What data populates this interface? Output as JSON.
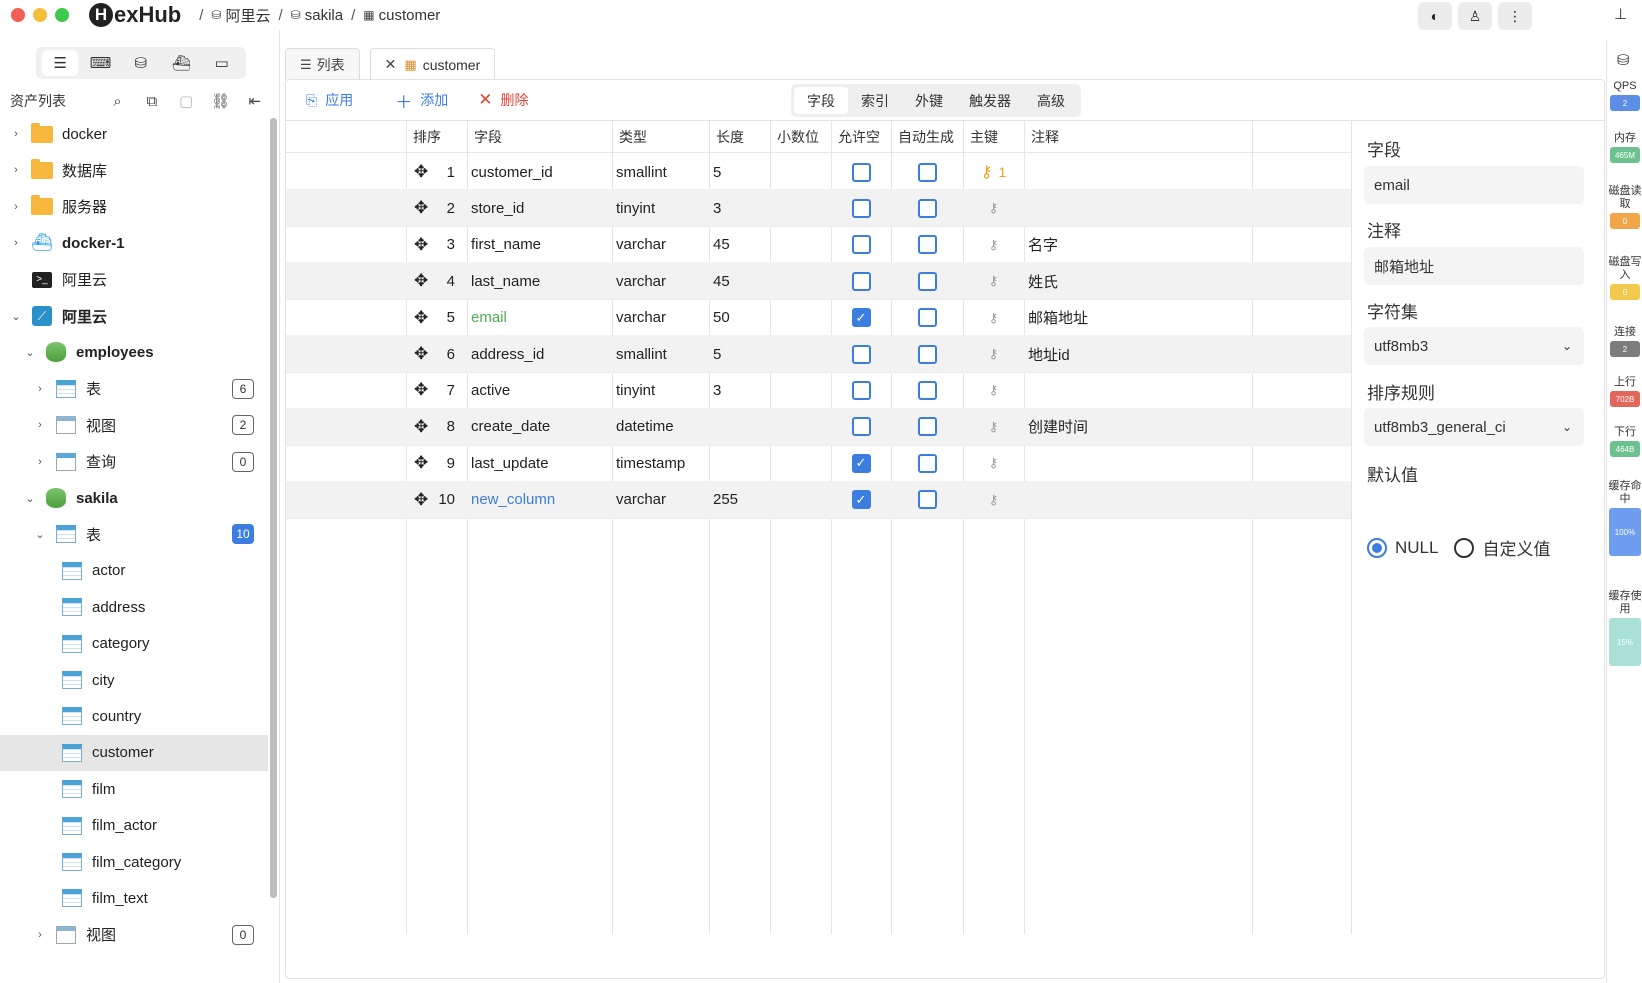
{
  "app": {
    "brand": "HexHub",
    "brand_initial": "H",
    "brand_rest": "exHub",
    "breadcrumbs": [
      "阿里云",
      "sakila",
      "customer"
    ]
  },
  "sidebar": {
    "asset_label": "资产列表",
    "tree": [
      {
        "label": "docker",
        "icon": "folder-icon",
        "chevron": "›"
      },
      {
        "label": "数据库",
        "icon": "folder-icon",
        "chevron": "›"
      },
      {
        "label": "服务器",
        "icon": "folder-icon",
        "chevron": "›"
      },
      {
        "label": "docker-1",
        "icon": "docker-icon",
        "chevron": "›"
      },
      {
        "label": "阿里云",
        "icon": "terminal-icon",
        "chevron": ""
      },
      {
        "label": "阿里云",
        "icon": "cloud-server-icon",
        "chevron": "⌄"
      },
      {
        "label": "employees",
        "icon": "database-icon",
        "chevron": "⌄"
      },
      {
        "label": "表",
        "icon": "table-icon",
        "chevron": "›",
        "badge": "6"
      },
      {
        "label": "视图",
        "icon": "view-icon",
        "chevron": "›",
        "badge": "2"
      },
      {
        "label": "查询",
        "icon": "query-icon",
        "chevron": "›",
        "badge": "0"
      },
      {
        "label": "sakila",
        "icon": "database-icon",
        "chevron": "⌄"
      },
      {
        "label": "表",
        "icon": "table-icon",
        "chevron": "⌄",
        "badge": "10"
      },
      {
        "label": "actor",
        "icon": "table-icon"
      },
      {
        "label": "address",
        "icon": "table-icon"
      },
      {
        "label": "category",
        "icon": "table-icon"
      },
      {
        "label": "city",
        "icon": "table-icon"
      },
      {
        "label": "country",
        "icon": "table-icon"
      },
      {
        "label": "customer",
        "icon": "table-icon",
        "selected": true
      },
      {
        "label": "film",
        "icon": "table-icon"
      },
      {
        "label": "film_actor",
        "icon": "table-icon"
      },
      {
        "label": "film_category",
        "icon": "table-icon"
      },
      {
        "label": "film_text",
        "icon": "table-icon"
      },
      {
        "label": "视图",
        "icon": "view-icon",
        "chevron": "›",
        "badge": "0"
      }
    ]
  },
  "tabs": {
    "list_label": "列表",
    "active_label": "customer"
  },
  "toolbar": {
    "apply": "应用",
    "add": "添加",
    "delete": "删除",
    "segments": [
      "字段",
      "索引",
      "外键",
      "触发器",
      "高级"
    ],
    "active_segment": "字段"
  },
  "grid": {
    "headers": [
      "排序",
      "字段",
      "类型",
      "长度",
      "小数位",
      "允许空",
      "自动生成",
      "主键",
      "注释"
    ],
    "rows": [
      {
        "num": "1",
        "field": "customer_id",
        "type": "smallint",
        "length": "5",
        "decimals": "",
        "nullable": false,
        "auto": false,
        "pk": true,
        "pk_order": "1",
        "comment": ""
      },
      {
        "num": "2",
        "field": "store_id",
        "type": "tinyint",
        "length": "3",
        "decimals": "",
        "nullable": false,
        "auto": false,
        "pk": false,
        "pk_order": "",
        "comment": ""
      },
      {
        "num": "3",
        "field": "first_name",
        "type": "varchar",
        "length": "45",
        "decimals": "",
        "nullable": false,
        "auto": false,
        "pk": false,
        "pk_order": "",
        "comment": "名字"
      },
      {
        "num": "4",
        "field": "last_name",
        "type": "varchar",
        "length": "45",
        "decimals": "",
        "nullable": false,
        "auto": false,
        "pk": false,
        "pk_order": "",
        "comment": "姓氏"
      },
      {
        "num": "5",
        "field": "email",
        "type": "varchar",
        "length": "50",
        "decimals": "",
        "nullable": true,
        "auto": false,
        "pk": false,
        "pk_order": "",
        "comment": "邮箱地址",
        "field_color": "#4caf50"
      },
      {
        "num": "6",
        "field": "address_id",
        "type": "smallint",
        "length": "5",
        "decimals": "",
        "nullable": false,
        "auto": false,
        "pk": false,
        "pk_order": "",
        "comment": "地址id"
      },
      {
        "num": "7",
        "field": "active",
        "type": "tinyint",
        "length": "3",
        "decimals": "",
        "nullable": false,
        "auto": false,
        "pk": false,
        "pk_order": "",
        "comment": ""
      },
      {
        "num": "8",
        "field": "create_date",
        "type": "datetime",
        "length": "",
        "decimals": "",
        "nullable": false,
        "auto": false,
        "pk": false,
        "pk_order": "",
        "comment": "创建时间"
      },
      {
        "num": "9",
        "field": "last_update",
        "type": "timestamp",
        "length": "",
        "decimals": "",
        "nullable": true,
        "auto": false,
        "pk": false,
        "pk_order": "",
        "comment": ""
      },
      {
        "num": "10",
        "field": "new_column",
        "type": "varchar",
        "length": "255",
        "decimals": "",
        "nullable": true,
        "auto": false,
        "pk": false,
        "pk_order": "",
        "comment": "",
        "field_color": "#3b7ee0"
      }
    ]
  },
  "properties": {
    "field_label": "字段",
    "field_value": "email",
    "comment_label": "注释",
    "comment_value": "邮箱地址",
    "charset_label": "字符集",
    "charset_value": "utf8mb3",
    "collation_label": "排序规则",
    "collation_value": "utf8mb3_general_ci",
    "default_label": "默认值",
    "default_null": "NULL",
    "default_custom": "自定义值",
    "default_selected": "NULL"
  },
  "monitor": {
    "items": [
      {
        "label": "QPS",
        "value": "2",
        "color": "#5b8fe6"
      },
      {
        "label": "内存",
        "value": "465M",
        "color": "#6cc18f"
      },
      {
        "label": "磁盘读取",
        "value": "0",
        "color": "#f2a64a"
      },
      {
        "label": "磁盘写入",
        "value": "0",
        "color": "#f2c94c"
      },
      {
        "label": "连接",
        "value": "2",
        "color": "#7c7c7c"
      },
      {
        "label": "上行",
        "value": "702B",
        "color": "#e0675a"
      },
      {
        "label": "下行",
        "value": "464B",
        "color": "#6cc18f"
      },
      {
        "label": "缓存命中",
        "value": "100%",
        "color": "#6f9ef0"
      },
      {
        "label": "缓存使用",
        "value": "15%",
        "color": "#a9e0d8"
      }
    ]
  },
  "colors": {
    "accent": "#3b7ee0",
    "danger": "#e0463a",
    "primary_key": "#f0a020"
  }
}
